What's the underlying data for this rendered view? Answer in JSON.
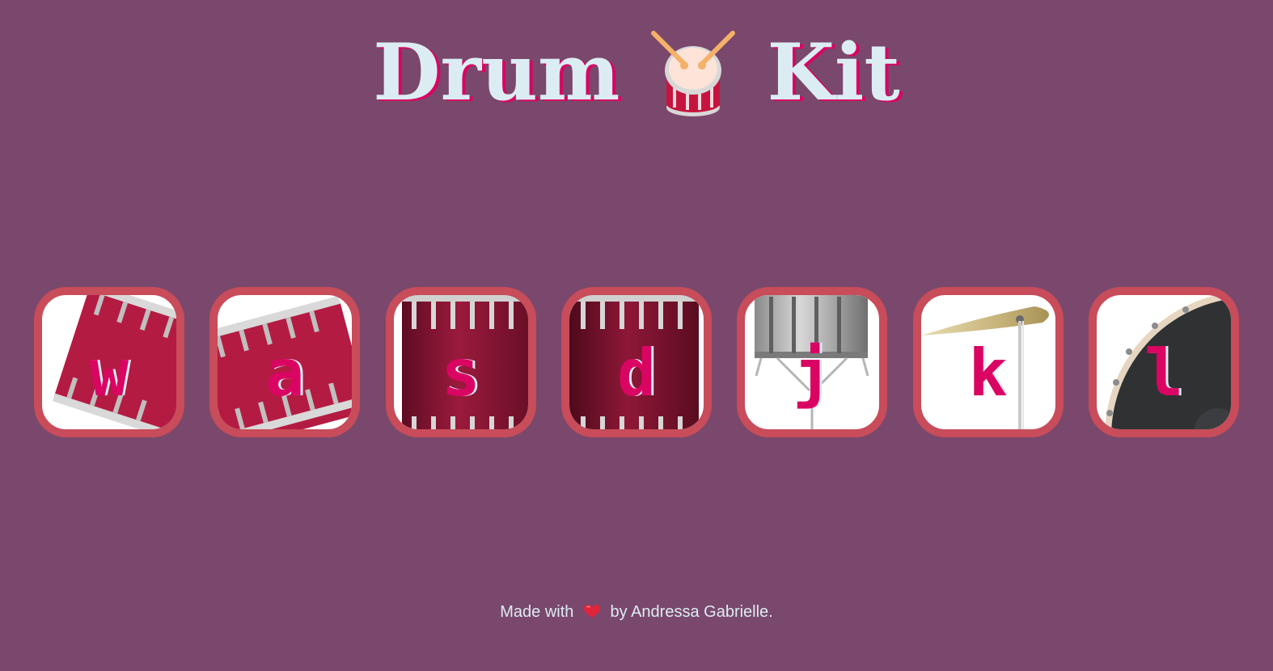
{
  "header": {
    "title_left": "Drum",
    "title_right": "Kit",
    "title_icon": "drum-emoji-icon"
  },
  "drums": [
    {
      "key": "w",
      "kind": "crash",
      "icon": "tilted-red-drum"
    },
    {
      "key": "a",
      "kind": "kick",
      "icon": "tilted-red-drum"
    },
    {
      "key": "s",
      "kind": "snare",
      "icon": "red-drum-shell"
    },
    {
      "key": "d",
      "kind": "tom",
      "icon": "red-drum-shell"
    },
    {
      "key": "j",
      "kind": "snare",
      "icon": "silver-snare-drum"
    },
    {
      "key": "k",
      "kind": "crash",
      "icon": "cymbal"
    },
    {
      "key": "l",
      "kind": "kick",
      "icon": "black-drum-head"
    }
  ],
  "footer": {
    "prefix": "Made with",
    "suffix": "by Andressa Gabrielle.",
    "icon": "heart-icon"
  },
  "colors": {
    "background": "#7a486c",
    "title_text": "#dbedf3",
    "title_shadow": "#da0463",
    "drum_border": "#c84c5a",
    "key_text": "#da0463"
  }
}
